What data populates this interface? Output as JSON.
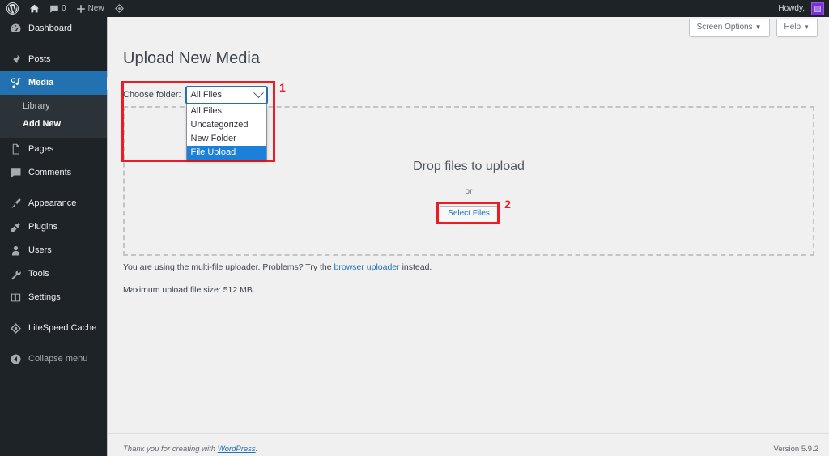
{
  "adminbar": {
    "wp_logo_icon": "wordpress-logo-icon",
    "site_home_icon": "home-icon",
    "comments_icon": "comment-bubble-icon",
    "comments_count": "0",
    "new_icon": "plus-icon",
    "new_label": "New",
    "litespeed_icon": "litespeed-diamond-icon",
    "howdy": "Howdy,",
    "avatar_name": "user-avatar"
  },
  "sidebar": {
    "items": [
      {
        "label": "Dashboard",
        "icon": "dashboard-icon",
        "current": false
      },
      {
        "label": "Posts",
        "icon": "pin-icon",
        "current": false
      },
      {
        "label": "Media",
        "icon": "media-icon",
        "current": true
      },
      {
        "label": "Pages",
        "icon": "pages-icon",
        "current": false
      },
      {
        "label": "Comments",
        "icon": "comment-bubble-icon",
        "current": false
      },
      {
        "label": "Appearance",
        "icon": "paintbrush-icon",
        "current": false
      },
      {
        "label": "Plugins",
        "icon": "plug-icon",
        "current": false
      },
      {
        "label": "Users",
        "icon": "user-icon",
        "current": false
      },
      {
        "label": "Tools",
        "icon": "wrench-icon",
        "current": false
      },
      {
        "label": "Settings",
        "icon": "settings-sliders-icon",
        "current": false
      },
      {
        "label": "LiteSpeed Cache",
        "icon": "litespeed-diamond-icon",
        "current": false
      }
    ],
    "media_submenu": [
      {
        "label": "Library",
        "current": false
      },
      {
        "label": "Add New",
        "current": true
      }
    ],
    "collapse": {
      "label": "Collapse menu",
      "icon": "collapse-arrow-icon"
    }
  },
  "screen_meta": {
    "screen_options": "Screen Options",
    "help": "Help",
    "caret_icon": "chevron-down-icon"
  },
  "main": {
    "page_title": "Upload New Media",
    "folder_label": "Choose folder:",
    "folder_select": {
      "name": "folder-select",
      "value": "All Files",
      "chevron_icon": "chevron-down-icon",
      "options": [
        {
          "label": "All Files",
          "selected": false
        },
        {
          "label": "Uncategorized",
          "selected": false
        },
        {
          "label": "New Folder",
          "selected": false
        },
        {
          "label": "File Upload",
          "selected": true
        }
      ]
    },
    "dropzone": {
      "title": "Drop files to upload",
      "or": "or",
      "select_files": "Select Files"
    },
    "uploader_note_prefix": "You are using the multi-file uploader. Problems? Try the ",
    "uploader_note_link": "browser uploader",
    "uploader_note_suffix": " instead.",
    "max_upload": "Maximum upload file size: 512 MB."
  },
  "annotations": [
    {
      "number": "1",
      "target": "folder-select-callout"
    },
    {
      "number": "2",
      "target": "select-files-callout"
    }
  ],
  "footer": {
    "thanks_prefix": "Thank you for creating with ",
    "thanks_link": "WordPress",
    "thanks_suffix": ".",
    "version": "Version 5.9.2"
  },
  "colors": {
    "sidebar_bg": "#1d2327",
    "submenu_bg": "#2c3338",
    "active_blue": "#2271b1",
    "option_highlight": "#1a80da",
    "annotation_red": "#ed1c24",
    "content_bg": "#f0f0f1",
    "avatar_purple": "#7b2fd6"
  }
}
